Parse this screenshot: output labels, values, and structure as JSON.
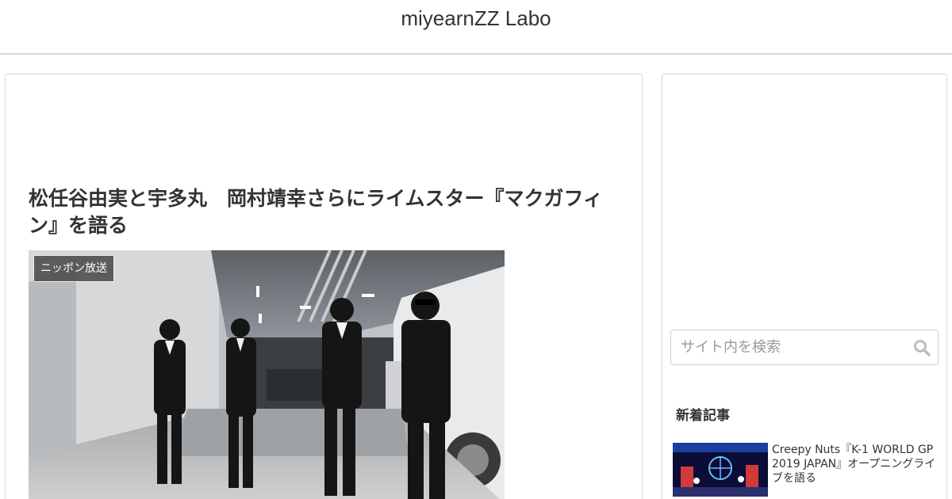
{
  "header": {
    "site_title": "miyearnZZ Labo"
  },
  "article": {
    "title": "松任谷由実と宇多丸　岡村靖幸さらにライムスター『マクガフィン』を語る",
    "category_label": "ニッポン放送"
  },
  "sidebar": {
    "search": {
      "placeholder": "サイト内を検索"
    },
    "recent": {
      "title": "新着記事",
      "items": [
        {
          "title": "Creepy Nuts『K-1 WORLD GP 2019 JAPAN』オープニングライブを語る"
        }
      ]
    }
  },
  "colors": {
    "header_border": "#d8d8d8",
    "card_border": "#d6d6d6",
    "label_bg": "#464646"
  },
  "icons": {
    "search": "search-icon"
  }
}
